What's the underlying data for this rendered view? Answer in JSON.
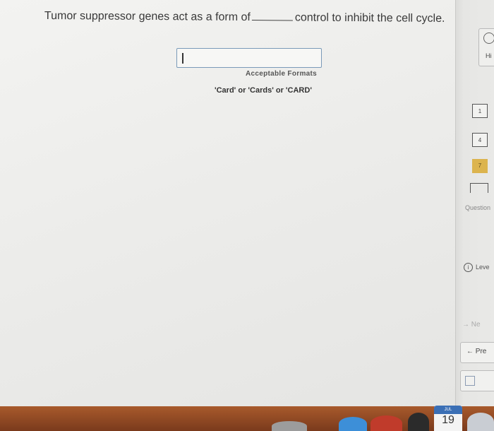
{
  "question": {
    "before_blank": "Tumor suppressor genes act as a form of",
    "after_blank": "control to inhibit the cell cycle."
  },
  "answer": {
    "value": ""
  },
  "formats": {
    "title": "Acceptable Formats",
    "list": "'Card' or 'Cards' or 'CARD'"
  },
  "sidebar": {
    "timer_label": "Hi",
    "question_numbers": [
      "1",
      "4",
      "7"
    ],
    "active_question": "7",
    "questions_label": "Question",
    "level_label": "Leve",
    "next_label": "Ne",
    "prev_label": "Pre",
    "colors": {
      "active": "#dcb44e"
    }
  },
  "dock": {
    "calendar_month": "JUL",
    "calendar_day": "19"
  }
}
